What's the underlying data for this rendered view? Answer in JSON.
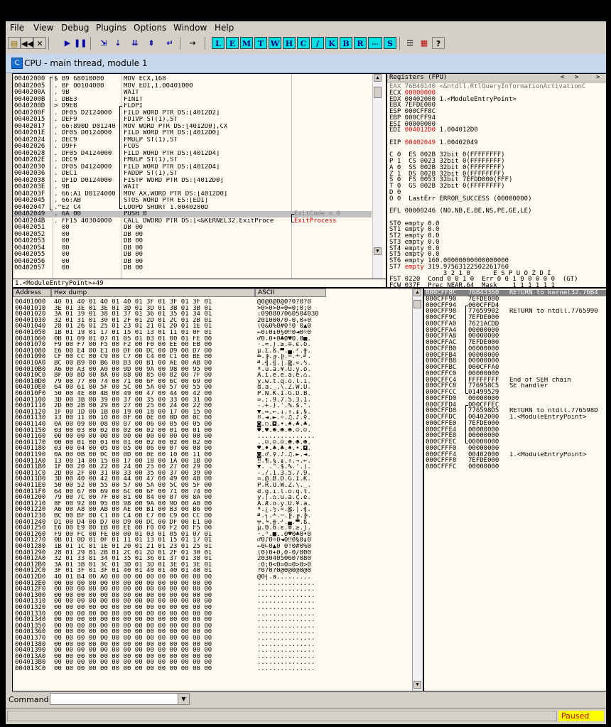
{
  "menu": [
    "File",
    "View",
    "Debug",
    "Plugins",
    "Options",
    "Window",
    "Help"
  ],
  "toolbar": {
    "letters": [
      "L",
      "E",
      "M",
      "T",
      "W",
      "H",
      "C",
      "/",
      "K",
      "B",
      "R",
      "...",
      "S"
    ]
  },
  "window": {
    "title": "CPU - main thread, module 1",
    "icon_letter": "C"
  },
  "disasm": {
    "rows": [
      {
        "addr": "00402000",
        "hex": "$ B9 68010000",
        "instr": "MOV ECX,168"
      },
      {
        "addr": "00402005",
        "hex": ". BF 00104000",
        "instr": "MOV EDI,1.00401000"
      },
      {
        "addr": "0040200A",
        "hex": ". 9B",
        "instr": "WAIT"
      },
      {
        "addr": "0040200B",
        "hex": ". DBE3",
        "instr": "FINIT"
      },
      {
        "addr": "0040200D",
        "hex": "> D9EB",
        "instr": "FLDPI"
      },
      {
        "addr": "0040200F",
        "hex": ". DF05 D2124000",
        "instr": "FILD WORD PTR DS:[4012D2]"
      },
      {
        "addr": "00402015",
        "hex": ". DEF9",
        "instr": "FDIVP ST(1),ST"
      },
      {
        "addr": "00402017",
        "hex": ". 66:890D D01240",
        "instr": "MOV WORD PTR DS:[4012D0],CX"
      },
      {
        "addr": "0040201E",
        "hex": ". DF05 D0124000",
        "instr": "FILD WORD PTR DS:[4012D0]"
      },
      {
        "addr": "00402024",
        "hex": ". DEC9",
        "instr": "FMULP ST(1),ST"
      },
      {
        "addr": "00402026",
        "hex": ". D9FF",
        "instr": "FCOS"
      },
      {
        "addr": "00402028",
        "hex": ". DF05 D4124000",
        "instr": "FILD WORD PTR DS:[4012D4]"
      },
      {
        "addr": "0040202E",
        "hex": ". DEC9",
        "instr": "FMULP ST(1),ST"
      },
      {
        "addr": "00402030",
        "hex": ". DF05 D4124000",
        "instr": "FILD WORD PTR DS:[4012D4]"
      },
      {
        "addr": "00402036",
        "hex": ". DEC1",
        "instr": "FADDP ST(1),ST"
      },
      {
        "addr": "00402038",
        "hex": ". DF1D D0124000",
        "instr": "FISTP WORD PTR DS:[4012D0]"
      },
      {
        "addr": "0040203E",
        "hex": ". 9B",
        "instr": "WAIT"
      },
      {
        "addr": "0040203F",
        "hex": ". 66:A1 D0124000",
        "instr": "MOV AX,WORD PTR DS:[4012D0]"
      },
      {
        "addr": "00402045",
        "hex": ". 66:AB",
        "instr": "STOS WORD PTR ES:[EDI]"
      },
      {
        "addr": "00402047",
        "hex": ".^E2 C4",
        "instr": "LOOPD SHORT 1.0040200D"
      },
      {
        "addr": "00402049",
        "hex": ". 6A 00",
        "instr": "PUSH 0"
      },
      {
        "addr": "0040204B",
        "hex": ". FF15 40304000",
        "instr": "CALL DWORD PTR DS:[<&KERNEL32.ExitProce"
      },
      {
        "addr": "00402051",
        "hex": "  00",
        "instr": "DB 00"
      },
      {
        "addr": "00402052",
        "hex": "  00",
        "instr": "DB 00"
      },
      {
        "addr": "00402053",
        "hex": "  00",
        "instr": "DB 00"
      },
      {
        "addr": "00402054",
        "hex": "  00",
        "instr": "DB 00"
      },
      {
        "addr": "00402055",
        "hex": "  00",
        "instr": "DB 00"
      },
      {
        "addr": "00402056",
        "hex": "  00",
        "instr": "DB 00"
      },
      {
        "addr": "00402057",
        "hex": "  00",
        "instr": "DB 00"
      }
    ],
    "comment_exitcode": "ExitCode = 0",
    "comment_exitprocess": "ExitProcess",
    "info_line": "1.<ModuleEntryPoint>+49"
  },
  "registers": {
    "title": "Registers (FPU)",
    "lines": [
      {
        "t": "EAX 76B40140 <&ntdll.RtlQueryInformationActivationC",
        "red": false
      },
      {
        "t": "ECX 00000000",
        "red": true
      },
      {
        "t": "EDX 00402000 1.<ModuleEntryPoint>",
        "red": false
      },
      {
        "t": "EBX 7EFDE000",
        "red": false
      },
      {
        "t": "ESP 000CFF8C",
        "red": false
      },
      {
        "t": "EBP 000CFF94",
        "red": false
      },
      {
        "t": "ESI 00000000",
        "red": false
      },
      {
        "t": "EDI 004012D0 1.004012D0",
        "red": true
      },
      {
        "t": "",
        "red": false
      },
      {
        "t": "EIP 00402049 1.00402049",
        "red": true
      },
      {
        "t": "",
        "red": false
      },
      {
        "t": "C 0  ES 002B 32bit 0(FFFFFFFF)",
        "red": false
      },
      {
        "t": "P 1  CS 0023 32bit 0(FFFFFFFF)",
        "red": false
      },
      {
        "t": "A 0  SS 002B 32bit 0(FFFFFFFF)",
        "red": false
      },
      {
        "t": "Z 1  DS 002B 32bit 0(FFFFFFFF)",
        "red": false
      },
      {
        "t": "S 0  FS 0053 32bit 7EFDD000(FFF)",
        "red": false
      },
      {
        "t": "T 0  GS 002B 32bit 0(FFFFFFFF)",
        "red": false
      },
      {
        "t": "D 0",
        "red": false
      },
      {
        "t": "O 0  LastErr ERROR_SUCCESS (00000000)",
        "red": false
      },
      {
        "t": "",
        "red": false
      },
      {
        "t": "EFL 00000246 (NO,NB,E,BE,NS,PE,GE,LE)",
        "red": false
      },
      {
        "t": "",
        "red": false
      },
      {
        "t": "ST0 empty 0.0",
        "red": false
      },
      {
        "t": "ST1 empty 0.0",
        "red": false
      },
      {
        "t": "ST2 empty 0.0",
        "red": false
      },
      {
        "t": "ST3 empty 0.0",
        "red": false
      },
      {
        "t": "ST4 empty 0.0",
        "red": false
      },
      {
        "t": "ST5 empty 0.0",
        "red": false
      },
      {
        "t": "ST6 empty 160.00000000000000000",
        "red": false
      },
      {
        "t": "ST7 empty 319.97563122502261760",
        "red": true
      },
      {
        "t": "              3 2 1 0      E S P U O Z D I",
        "red": false
      },
      {
        "t": "FST 0220  Cond 0 0 1 0  Err 0 0 1 0 0 0 0 0  (GT)",
        "red": false
      },
      {
        "t": "FCW 037F  Prec NEAR,64  Mask    1 1 1 1 1 1",
        "red": false
      }
    ]
  },
  "dump": {
    "headers": {
      "address": "Address",
      "hex": "Hex dump",
      "ascii": "ASCII"
    },
    "rows": [
      {
        "a": "00401000",
        "h": "40 01 40 01 40 01 40 01 3F 01 3F 01 3F 01",
        "s": "@0@0@0@0?0?0?0"
      },
      {
        "a": "00401010",
        "h": "3E 01 3E 01 3E 01 3D 01 3D 01 3B 01 3B 01",
        "s": ">0>0>0=0=0;0;0"
      },
      {
        "a": "00401020",
        "h": "3A 01 39 01 38 01 37 01 36 01 35 01 34 01",
        "s": ":090807060504030"
      },
      {
        "a": "00401030",
        "h": "32 01 31 01 30 01 2F 01 2D 01 2C 01 2B 01",
        "s": "201000/0-0,0+0"
      },
      {
        "a": "00401040",
        "h": "28 01 26 01 25 01 23 01 21 01 20 01 1E 01",
        "s": "(0&0%0#0!0 0▲0"
      },
      {
        "a": "00401050",
        "h": "1B 01 19 01 17 01 15 01 13 01 11 01 0F 01",
        "s": "←0↓0↨0§0‼0◄0☼0"
      },
      {
        "a": "00401060",
        "h": "0B 01 09 01 07 01 05 01 03 01 00 01 FE 00",
        "s": "♂0.0•0♣0♥0.0■."
      },
      {
        "a": "00401070",
        "h": "F9 00 F7 00 F5 00 F2 00 F0 00 EE 00 EB 00",
        "s": "·.≈.⌡.≥.≡.ε.δ."
      },
      {
        "a": "00401080",
        "h": "E6 00 E4 00 E1 00 DF 00 DC 00 D9 00 D7 00",
        "s": "µ.Σ.ß.▀.▄.┘.╫."
      },
      {
        "a": "00401090",
        "h": "CF 00 CC 00 C9 00 C7 00 C4 00 C1 00 BE 00",
        "s": "╧.╠.╔.╟.─.┴.╛."
      },
      {
        "a": "004010A0",
        "h": "BC 00 B9 00 B6 00 B3 00 B1 00 AE 00 AB 00",
        "s": "╝.╣.╢.│.▒.«.½."
      },
      {
        "a": "004010B0",
        "h": "A6 00 A3 00 A0 00 9D 00 9A 00 98 00 95 00",
        "s": "ª.ú.á.¥.Ü.ÿ.ò."
      },
      {
        "a": "004010C0",
        "h": "8F 00 8D 00 8A 00 88 00 85 00 82 00 7F 00",
        "s": "Å.ì.è.ê.à.é.⌂."
      },
      {
        "a": "004010D0",
        "h": "79 00 77 00 74 00 71 00 6F 00 6C 00 69 00",
        "s": "y.w.t.q.o.l.i."
      },
      {
        "a": "004010E0",
        "h": "64 00 61 00 5F 00 5C 00 5A 00 57 00 55 00",
        "s": "d.a._.\\.Z.W.U."
      },
      {
        "a": "004010F0",
        "h": "50 00 4E 00 4B 00 49 00 47 00 44 00 42 00",
        "s": "P.N.K.I.G.D.B."
      },
      {
        "a": "00401100",
        "h": "3D 00 3B 00 39 00 37 00 35 00 33 00 31 00",
        "s": "=.;.9.7.5.3.1."
      },
      {
        "a": "00401110",
        "h": "2D 00 2B 00 29 00 27 00 25 00 24 00 22 00",
        "s": "-.+.).'.%.$.\"."
      },
      {
        "a": "00401120",
        "h": "1F 00 1D 00 1B 00 19 00 18 00 17 00 15 00",
        "s": "▼.↔.←.↓.↑.↨.§."
      },
      {
        "a": "00401130",
        "h": "13 00 11 00 10 00 0F 00 0E 00 0D 00 0C 00",
        "s": "‼.◄.►.☼.♫.♪.♀."
      },
      {
        "a": "00401140",
        "h": "0A 00 09 00 08 00 07 00 06 00 05 00 05 00",
        "s": "◙.○.◘.•.♠.♣.♣."
      },
      {
        "a": "00401150",
        "h": "03 00 03 00 02 00 02 00 02 00 01 00 01 00",
        "s": "♥.♥.☻.☻.☻.☺.☺."
      },
      {
        "a": "00401160",
        "h": "00 00 00 00 00 00 00 00 00 00 00 00 00 00",
        "s": "..............."
      },
      {
        "a": "00401170",
        "h": "00 00 01 00 01 00 01 00 02 00 02 00 02 00",
        "s": "..☺.☺.☺.☻.☻.☻."
      },
      {
        "a": "00401180",
        "h": "03 00 04 00 05 00 05 00 06 00 07 00 08 00",
        "s": "♥.♦.♣.♣.♠.•.◘."
      },
      {
        "a": "00401190",
        "h": "0A 00 0B 00 0C 00 0D 00 0E 00 10 00 11 00",
        "s": "◙.♂.♀.♪.♫.►.◄."
      },
      {
        "a": "004011A0",
        "h": "13 00 14 00 15 00 17 00 18 00 1A 00 1B 00",
        "s": "‼.¶.§.↨.↑.→.←."
      },
      {
        "a": "004011B0",
        "h": "1F 00 20 00 22 00 24 00 25 00 27 00 29 00",
        "s": "▼. .\".$.%.'.)."
      },
      {
        "a": "004011C0",
        "h": "2D 00 2F 00 31 00 33 00 35 00 37 00 39 00",
        "s": "-./.1.3.5.7.9."
      },
      {
        "a": "004011D0",
        "h": "3D 00 40 00 42 00 44 00 47 00 49 00 4B 00",
        "s": "=.@.B.D.G.I.K."
      },
      {
        "a": "004011E0",
        "h": "50 00 52 00 55 00 57 00 5A 00 5C 00 5F 00",
        "s": "P.R.U.W.Z.\\._."
      },
      {
        "a": "004011F0",
        "h": "64 00 67 00 69 00 6C 00 6F 00 71 00 74 00",
        "s": "d.g.i.l.o.q.t."
      },
      {
        "a": "00401200",
        "h": "79 00 7C 00 7F 00 81 00 84 00 87 00 8A 00",
        "s": "y.|.⌂.ü.ä.ç.è."
      },
      {
        "a": "00401210",
        "h": "8F 00 92 00 95 00 98 00 9A 00 9D 00 A0 00",
        "s": "Å.Æ.ò.ÿ.Ü.¥.á."
      },
      {
        "a": "00401220",
        "h": "A6 00 A8 00 AB 00 AE 00 B1 00 B3 00 B6 00",
        "s": "ª.¿.½.«.▒.│.╢."
      },
      {
        "a": "00401230",
        "h": "BC 00 BF 00 C1 00 C4 00 C7 00 C9 00 CC 00",
        "s": "╝.┐.┴.─.╟.╔.╠."
      },
      {
        "a": "00401240",
        "h": "D1 00 D4 00 D7 00 D9 00 DC 00 DF 00 E1 00",
        "s": "╤.╘.╫.┘.▄.▀.ß."
      },
      {
        "a": "00401250",
        "h": "E6 00 E9 00 EB 00 EE 00 F0 00 F2 00 F5 00",
        "s": "µ.Θ.δ.ε.≡.≥.⌡."
      },
      {
        "a": "00401260",
        "h": "F9 00 FC 00 FE 00 00 01 03 01 05 01 07 01",
        "s": "·.ⁿ.■..0♥0♣0•0"
      },
      {
        "a": "00401270",
        "h": "0B 01 0D 01 0F 01 11 01 13 01 15 01 17 01",
        "s": "♂0♪0☼0◄0‼0§0↨0"
      },
      {
        "a": "00401280",
        "h": "1B 01 1C 01 1E 01 20 01 21 01 23 01 25 01",
        "s": "←0∟0▲0 0!0#0%0"
      },
      {
        "a": "00401290",
        "h": "28 01 29 01 2B 01 2C 01 2D 01 2F 01 30 01",
        "s": "(0)0+0,0-0/000"
      },
      {
        "a": "004012A0",
        "h": "32 01 33 01 34 01 35 01 36 01 37 01 38 01",
        "s": "20304050607080"
      },
      {
        "a": "004012B0",
        "h": "3A 01 3B 01 3C 01 3D 01 3D 01 3E 01 3E 01",
        "s": ":0;0<0=0=0>0>0"
      },
      {
        "a": "004012C0",
        "h": "3F 01 3F 01 3F 01 40 01 40 01 40 01 40 01",
        "s": "?0?0?0@0@0@0@0"
      },
      {
        "a": "004012D0",
        "h": "40 01 B4 00 A0 00 00 00 00 00 00 00 00 00",
        "s": "@0┤.á........."
      },
      {
        "a": "004012E0",
        "h": "00 00 00 00 00 00 00 00 00 00 00 00 00 00",
        "s": "..............."
      },
      {
        "a": "004012F0",
        "h": "00 00 00 00 00 00 00 00 00 00 00 00 00 00",
        "s": "..............."
      },
      {
        "a": "00401300",
        "h": "00 00 00 00 00 00 00 00 00 00 00 00 00 00",
        "s": "..............."
      },
      {
        "a": "00401310",
        "h": "00 00 00 00 00 00 00 00 00 00 00 00 00 00",
        "s": "..............."
      },
      {
        "a": "00401320",
        "h": "00 00 00 00 00 00 00 00 00 00 00 00 00 00",
        "s": "..............."
      },
      {
        "a": "00401330",
        "h": "00 00 00 00 00 00 00 00 00 00 00 00 00 00",
        "s": "..............."
      },
      {
        "a": "00401340",
        "h": "00 00 00 00 00 00 00 00 00 00 00 00 00 00",
        "s": "..............."
      },
      {
        "a": "00401350",
        "h": "00 00 00 00 00 00 00 00 00 00 00 00 00 00",
        "s": "..............."
      },
      {
        "a": "00401360",
        "h": "00 00 00 00 00 00 00 00 00 00 00 00 00 00",
        "s": "..............."
      },
      {
        "a": "00401370",
        "h": "00 00 00 00 00 00 00 00 00 00 00 00 00 00",
        "s": "..............."
      },
      {
        "a": "00401380",
        "h": "00 00 00 00 00 00 00 00 00 00 00 00 00 00",
        "s": "..............."
      },
      {
        "a": "00401390",
        "h": "00 00 00 00 00 00 00 00 00 00 00 00 00 00",
        "s": "..............."
      },
      {
        "a": "004013A0",
        "h": "00 00 00 00 00 00 00 00 00 00 00 00 00 00",
        "s": "..............."
      },
      {
        "a": "004013B0",
        "h": "00 00 00 00 00 00 00 00 00 00 00 00 00 00",
        "s": "..............."
      },
      {
        "a": "004013C0",
        "h": "00 00 00 00 00 00 00 00 00 00 00 00 00 00",
        "s": "..............."
      }
    ]
  },
  "stack": {
    "rows": [
      {
        "a": "000CFF8C",
        "v": "76B43360",
        "c": "RETURN to kernel32.76B4"
      },
      {
        "a": "000CFF90",
        "v": "7EFDE000",
        "c": ""
      },
      {
        "a": "000CFF94",
        "v": "000CFFD4",
        "c": ""
      },
      {
        "a": "000CFF98",
        "v": "77659902",
        "c": "RETURN to ntdll.7765990"
      },
      {
        "a": "000CFF9C",
        "v": "7EFDE000",
        "c": ""
      },
      {
        "a": "000CFFA0",
        "v": "7621ACDD",
        "c": ""
      },
      {
        "a": "000CFFA4",
        "v": "00000000",
        "c": ""
      },
      {
        "a": "000CFFA8",
        "v": "00000000",
        "c": ""
      },
      {
        "a": "000CFFAC",
        "v": "7EFDE000",
        "c": ""
      },
      {
        "a": "000CFFB0",
        "v": "00000000",
        "c": ""
      },
      {
        "a": "000CFFB4",
        "v": "00000000",
        "c": ""
      },
      {
        "a": "000CFFB8",
        "v": "00000000",
        "c": ""
      },
      {
        "a": "000CFFBC",
        "v": "000CFFA0",
        "c": ""
      },
      {
        "a": "000CFFC0",
        "v": "00000000",
        "c": ""
      },
      {
        "a": "000CFFC4",
        "v": "FFFFFFFF",
        "c": "End of SEH chain"
      },
      {
        "a": "000CFFC8",
        "v": "776958C5",
        "c": "SE handler"
      },
      {
        "a": "000CFFCC",
        "v": "01499529",
        "c": ""
      },
      {
        "a": "000CFFD0",
        "v": "00000000",
        "c": ""
      },
      {
        "a": "000CFFD4",
        "v": "000CFFEC",
        "c": ""
      },
      {
        "a": "000CFFD8",
        "v": "776598D5",
        "c": "RETURN to ntdll.776598D"
      },
      {
        "a": "000CFFDC",
        "v": "00402000",
        "c": "1.<ModuleEntryPoint>"
      },
      {
        "a": "000CFFE0",
        "v": "7EFDE000",
        "c": ""
      },
      {
        "a": "000CFFE4",
        "v": "00000000",
        "c": ""
      },
      {
        "a": "000CFFE8",
        "v": "00000000",
        "c": ""
      },
      {
        "a": "000CFFEC",
        "v": "00000000",
        "c": ""
      },
      {
        "a": "000CFFF0",
        "v": "00000000",
        "c": ""
      },
      {
        "a": "000CFFF4",
        "v": "00402000",
        "c": "1.<ModuleEntryPoint>"
      },
      {
        "a": "000CFFF8",
        "v": "7EFDE000",
        "c": ""
      },
      {
        "a": "000CFFFC",
        "v": "00000000",
        "c": ""
      }
    ]
  },
  "command": {
    "label": "Command :",
    "value": ""
  },
  "status": {
    "state": "Paused"
  },
  "colors": {
    "pane_bg": "#fffbf0",
    "highlight": "#c0c0c0",
    "red": "#e00000",
    "paused_bg": "#ffff00",
    "paused_fg": "#c00000"
  }
}
